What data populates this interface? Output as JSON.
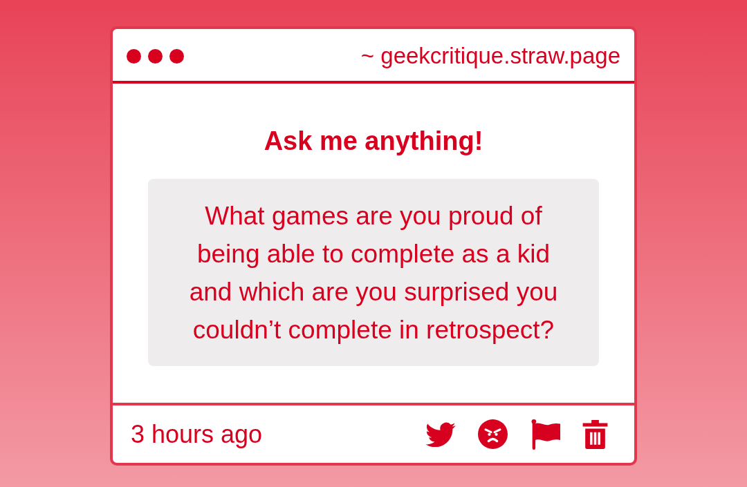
{
  "window": {
    "url": "~ geekcritique.straw.page"
  },
  "prompt": {
    "title": "Ask me anything!"
  },
  "question": {
    "text": "What games are you proud of being able to complete as a kid and which are you surprised you couldn’t complete in retrospect?"
  },
  "footer": {
    "time": "3 hours ago"
  }
}
